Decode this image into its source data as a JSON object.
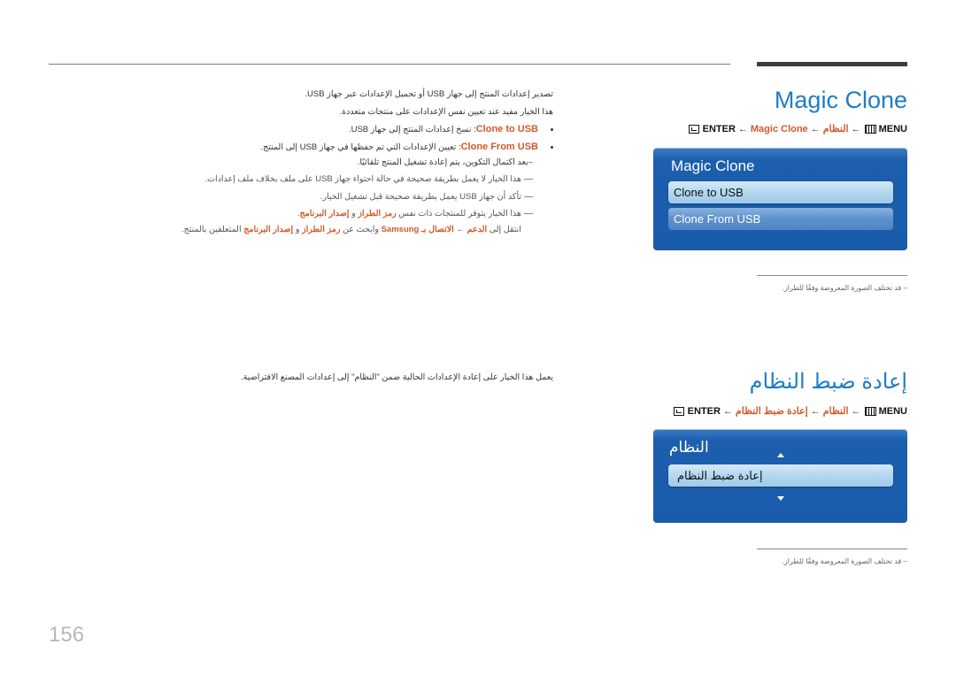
{
  "section1": {
    "title": "Magic Clone",
    "breadcrumb": {
      "enter": "ENTER",
      "arrow": "←",
      "item2": "Magic Clone",
      "item1": "النظام",
      "menu": "MENU"
    },
    "osd": {
      "title": "Magic Clone",
      "items": [
        {
          "label": "Clone to USB",
          "selected": true
        },
        {
          "label": "Clone From USB",
          "selected": false
        }
      ]
    },
    "note": "– قد تختلف الصورة المعروضة وفقًا للطراز.",
    "body": {
      "intro1": "تصدير إعدادات المنتج إلى جهاز USB أو تحميل الإعدادات عبر جهاز USB.",
      "intro2": "هذا الخيار مفيد عند تعيين نفس الإعدادات على منتجات متعددة.",
      "bullets": [
        {
          "term": "Clone to USB",
          "text": ": نسخ إعدادات المنتج إلى جهاز USB."
        },
        {
          "term": "Clone From USB",
          "text": ": تعيين الإعدادات التي تم حفظها في جهاز USB إلى المنتج."
        }
      ],
      "bullet2_sub": "–بعد اكتمال التكوين، يتم إعادة تشغيل المنتج تلقائيًا.",
      "notes": [
        "هذا الخيار لا يعمل بطريقة صحيحة في حالة احتواء جهاز USB على ملف بخلاف ملف إعدادات.",
        "تأكد أن جهاز USB يعمل بطريقة صحيحة قبل تشغيل الخيار."
      ],
      "note3": {
        "prefix": "هذا الخيار يتوفر للمنتجات ذات نفس ",
        "model_code": "رمز الطراز",
        "and": " و ",
        "sw_version": "إصدار البرنامج",
        "suffix": "."
      },
      "note3_line2": {
        "go_to": "انتقل إلى ",
        "support": "الدعم",
        "arrow": " ← ",
        "contact": "الاتصال بـ Samsung",
        "search": " وابحث عن ",
        "model_code": "رمز الطراز",
        "and": " و ",
        "sw_version": "إصدار البرنامج",
        "end": " المتعلقين بالمنتج."
      }
    }
  },
  "section2": {
    "title": "إعادة ضبط النظام",
    "breadcrumb": {
      "enter": "ENTER",
      "arrow": "←",
      "item2": "إعادة ضبط النظام",
      "item1": "النظام",
      "menu": "MENU"
    },
    "osd": {
      "title": "النظام",
      "items": [
        {
          "label": "إعادة ضبط النظام",
          "selected": true
        }
      ]
    },
    "note": "– قد تختلف الصورة المعروضة وفقًا للطراز.",
    "body": "يعمل هذا الخيار على إعادة الإعدادات الحالية ضمن \"النظام\" إلى إعدادات المصنع الافتراضية."
  },
  "page_number": "156"
}
